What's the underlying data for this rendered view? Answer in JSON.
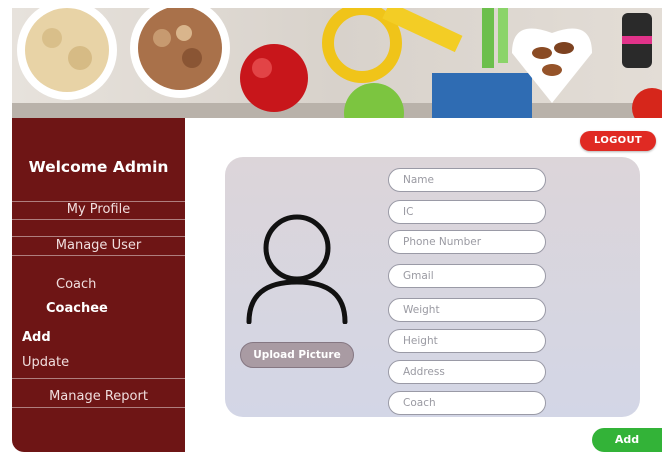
{
  "header": {
    "logout_label": "LOGOUT"
  },
  "sidebar": {
    "welcome": "Welcome Admin",
    "items": [
      {
        "label": "My Profile"
      },
      {
        "label": "Manage User"
      },
      {
        "label": "Coach"
      },
      {
        "label": "Coachee"
      },
      {
        "label": "Add"
      },
      {
        "label": "Update"
      },
      {
        "label": "Manage Report"
      }
    ]
  },
  "form": {
    "avatar_icon": "user-outline-icon",
    "upload_label": "Upload Picture",
    "fields": [
      {
        "placeholder": "Name",
        "value": ""
      },
      {
        "placeholder": "IC",
        "value": ""
      },
      {
        "placeholder": "Phone Number",
        "value": ""
      },
      {
        "placeholder": "Gmail",
        "value": ""
      },
      {
        "placeholder": "Weight",
        "value": ""
      },
      {
        "placeholder": "Height",
        "value": ""
      },
      {
        "placeholder": "Address",
        "value": ""
      },
      {
        "placeholder": "Coach",
        "value": ""
      }
    ],
    "submit_label": "Add"
  },
  "colors": {
    "sidebar_bg": "#6e1515",
    "logout": "#e02a23",
    "add_button": "#33b338",
    "upload_button": "#a99ba3"
  }
}
